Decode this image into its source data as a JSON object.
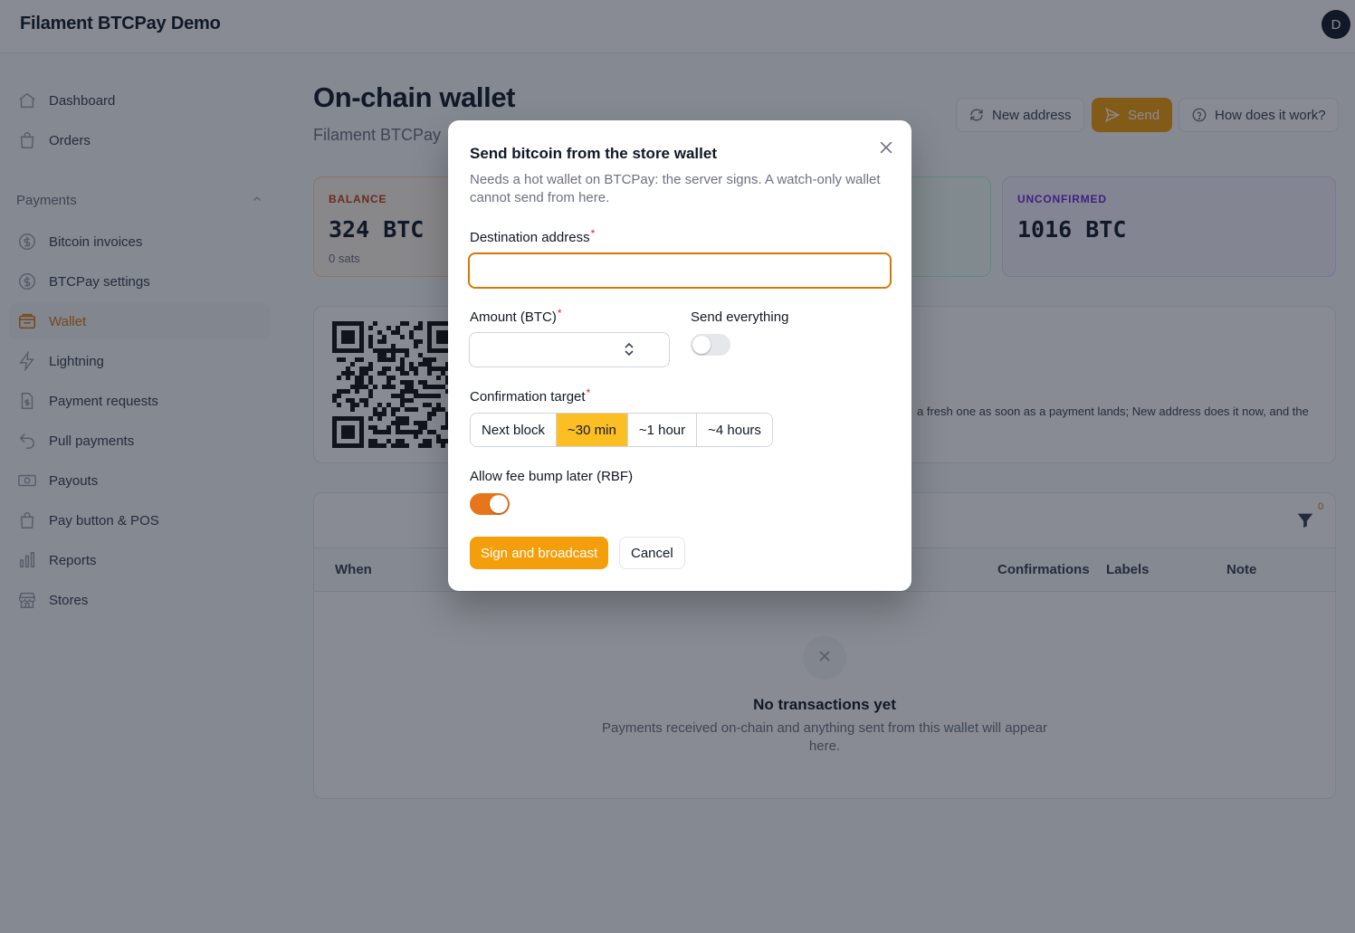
{
  "app": {
    "title": "Filament BTCPay Demo",
    "avatar_initial": "D"
  },
  "sidebar": {
    "top_items": [
      {
        "label": "Dashboard",
        "icon": "home-icon"
      },
      {
        "label": "Orders",
        "icon": "shopping-bag-icon"
      }
    ],
    "group_label": "Payments",
    "items": [
      {
        "label": "Bitcoin invoices",
        "icon": "dollar-circle-icon"
      },
      {
        "label": "BTCPay settings",
        "icon": "dollar-circle-icon"
      },
      {
        "label": "Wallet",
        "icon": "wallet-icon",
        "active": true
      },
      {
        "label": "Lightning",
        "icon": "bolt-icon"
      },
      {
        "label": "Payment requests",
        "icon": "document-dollar-icon"
      },
      {
        "label": "Pull payments",
        "icon": "arrow-uturn-left-icon"
      },
      {
        "label": "Payouts",
        "icon": "banknotes-icon"
      },
      {
        "label": "Pay button & POS",
        "icon": "shopping-bag-icon"
      },
      {
        "label": "Reports",
        "icon": "chart-bar-icon"
      },
      {
        "label": "Stores",
        "icon": "building-storefront-icon"
      }
    ]
  },
  "page": {
    "title": "On-chain wallet",
    "subtitle": "Filament BTCPay",
    "actions": {
      "new_address": "New address",
      "send": "Send",
      "how": "How does it work?"
    }
  },
  "stats": {
    "balance": {
      "label": "BALANCE",
      "value": "324 BTC",
      "sub": "0 sats"
    },
    "unconfirmed": {
      "label": "UNCONFIRMED",
      "value": "1016 BTC"
    }
  },
  "address_card": {
    "hint": "a fresh one as soon as a payment lands; New address does it now, and the"
  },
  "transactions": {
    "filter_count": "0",
    "columns": {
      "when": "When",
      "confirmations": "Confirmations",
      "labels": "Labels",
      "note": "Note"
    },
    "empty_title": "No transactions yet",
    "empty_desc": "Payments received on-chain and anything sent from this wallet will appear here."
  },
  "modal": {
    "title": "Send bitcoin from the store wallet",
    "description": "Needs a hot wallet on BTCPay: the server signs. A watch-only wallet cannot send from here.",
    "destination_label": "Destination address",
    "destination_value": "",
    "amount_label": "Amount (BTC)",
    "amount_value": "",
    "send_everything_label": "Send everything",
    "send_everything_on": false,
    "confirmation_label": "Confirmation target",
    "confirmation_options": [
      "Next block",
      "~30 min",
      "~1 hour",
      "~4 hours"
    ],
    "confirmation_selected": "~30 min",
    "rbf_label": "Allow fee bump later (RBF)",
    "rbf_on": true,
    "submit": "Sign and broadcast",
    "cancel": "Cancel",
    "required_mark": "*"
  },
  "colors": {
    "accent": "#f59e0b",
    "accent_dark": "#d97706",
    "toggle_on": "#e8751a"
  }
}
